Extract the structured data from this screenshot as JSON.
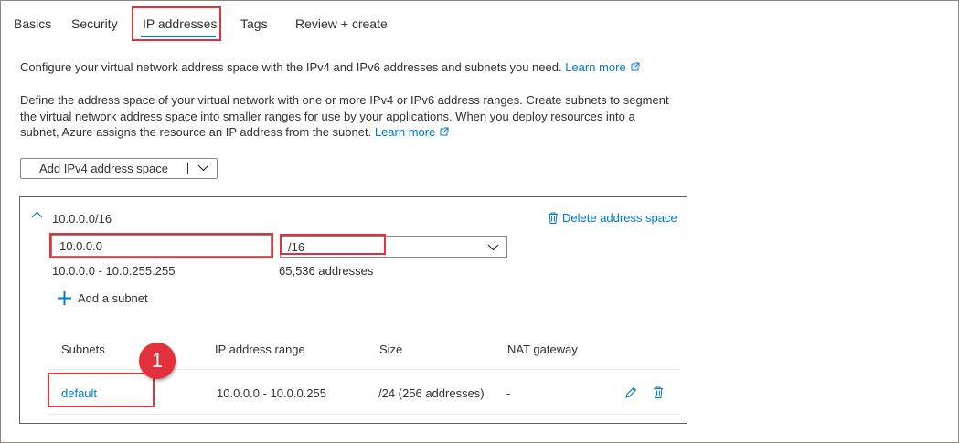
{
  "tabs": [
    {
      "label": "Basics"
    },
    {
      "label": "Security"
    },
    {
      "label": "IP addresses",
      "active": true
    },
    {
      "label": "Tags"
    },
    {
      "label": "Review + create"
    }
  ],
  "intro": {
    "text": "Configure your virtual network address space with the IPv4 and IPv6 addresses and subnets you need.",
    "link": "Learn more"
  },
  "description": {
    "line1": "Define the address space of your virtual network with one or more IPv4 or IPv6 address ranges. Create subnets to segment",
    "line2": "the virtual network address space into smaller ranges for use by your applications. When you deploy resources into a",
    "line3": "subnet, Azure assigns the resource an IP address from the subnet.",
    "link": "Learn more"
  },
  "add_address_space": {
    "label": "Add IPv4 address space"
  },
  "address_space": {
    "title": "10.0.0.0/16",
    "delete_label": "Delete address space",
    "address_value": "10.0.0.0",
    "prefix_value": "/16",
    "range_text": "10.0.0.0 - 10.0.255.255",
    "count_text": "65,536 addresses",
    "add_subnet_label": "Add a subnet"
  },
  "subnet_table": {
    "headers": [
      "Subnets",
      "IP address range",
      "Size",
      "NAT gateway"
    ],
    "rows": [
      {
        "name": "default",
        "range": "10.0.0.0 - 10.0.0.255",
        "size": "/24 (256 addresses)",
        "nat": "-"
      }
    ]
  },
  "callout": {
    "number": "1"
  },
  "colors": {
    "accent": "#0078d4",
    "highlight": "#e2313a",
    "border": "#8a8886"
  }
}
